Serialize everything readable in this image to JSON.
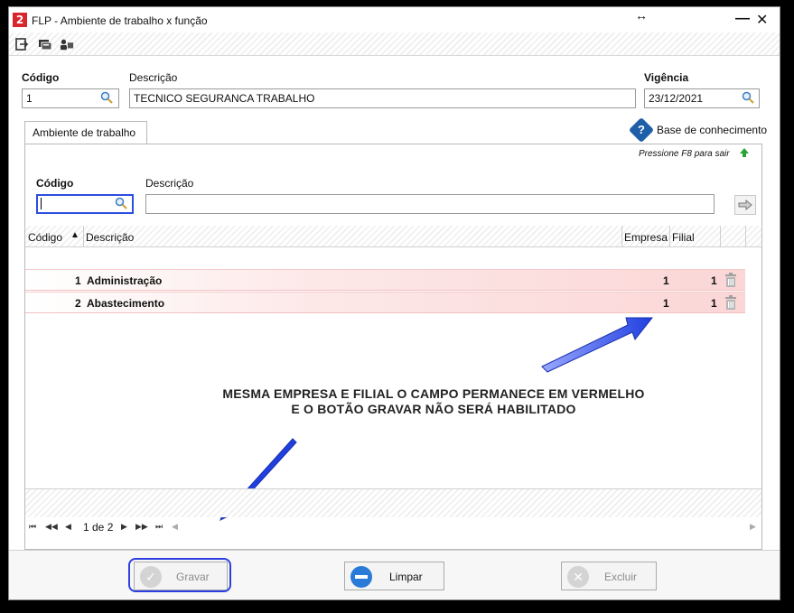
{
  "window": {
    "title": "FLP - Ambiente de trabalho x função",
    "app_icon_glyph": "2",
    "resize_glyph": "↔",
    "minimize_glyph": "—",
    "close_glyph": "✕"
  },
  "toolbar": {
    "icons": [
      "exit-icon",
      "cards-icon",
      "users-icon"
    ]
  },
  "header": {
    "codigo_label": "Código",
    "codigo_value": "1",
    "descricao_label": "Descrição",
    "descricao_value": "TECNICO SEGURANCA TRABALHO",
    "vigencia_label": "Vigência",
    "vigencia_value": "23/12/2021"
  },
  "tabs": [
    {
      "label": "Ambiente de trabalho",
      "active": true
    }
  ],
  "knowledge": {
    "label": "Base de conhecimento"
  },
  "hint": {
    "text": "Pressione F8 para sair"
  },
  "filter": {
    "codigo_label": "Código",
    "codigo_value": "",
    "descricao_label": "Descrição",
    "descricao_value": ""
  },
  "grid": {
    "columns": [
      "Código",
      "Descrição",
      "Empresa",
      "Filial"
    ],
    "sort_indicator": "▲",
    "rows": [
      {
        "codigo": "1",
        "descricao": "Administração",
        "empresa": "1",
        "filial": "1"
      },
      {
        "codigo": "2",
        "descricao": "Abastecimento",
        "empresa": "1",
        "filial": "1"
      }
    ],
    "row_highlight_color": "#fbd6d6"
  },
  "pager": {
    "text": "1 de 2",
    "first": "⏮",
    "prev_page": "◀◀",
    "prev": "◀",
    "next": "▶",
    "next_page": "▶▶",
    "last": "⏭"
  },
  "annotation": {
    "line1": "MESMA EMPRESA E FILIAL O CAMPO PERMANECE EM VERMELHO",
    "line2": "E O BOTÃO GRAVAR NÃO SERÁ HABILITADO",
    "arrow_color": "#1f3fe0"
  },
  "buttons": {
    "gravar": {
      "label": "Gravar",
      "enabled": false
    },
    "limpar": {
      "label": "Limpar",
      "enabled": true
    },
    "excluir": {
      "label": "Excluir",
      "enabled": false
    }
  }
}
